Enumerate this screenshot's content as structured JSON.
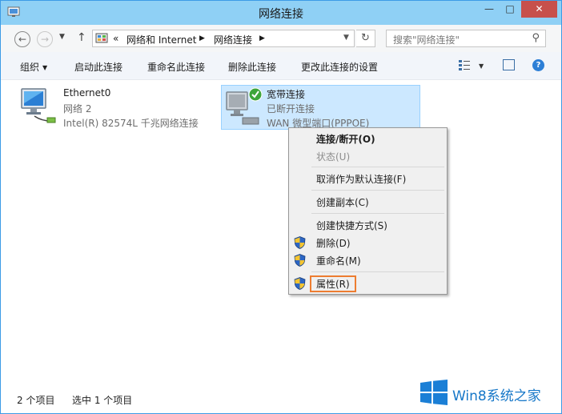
{
  "window": {
    "title": "网络连接"
  },
  "address_bar": {
    "overflow": "«",
    "segments": [
      "网络和 Internet",
      "网络连接"
    ]
  },
  "search": {
    "placeholder": "搜索\"网络连接\""
  },
  "command_bar": {
    "organize": "组织",
    "enable": "启动此连接",
    "rename": "重命名此连接",
    "delete": "删除此连接",
    "change_settings": "更改此连接的设置"
  },
  "connections": [
    {
      "name": "Ethernet0",
      "status": "网络 2",
      "device": "Intel(R) 82574L 千兆网络连接",
      "selected": false
    },
    {
      "name": "宽带连接",
      "status": "已断开连接",
      "device": "WAN 微型端口(PPPOE)",
      "selected": true
    }
  ],
  "context_menu": {
    "items": [
      {
        "label": "连接/断开(O)",
        "bold": true
      },
      {
        "label": "状态(U)",
        "disabled": true
      },
      {
        "label": "取消作为默认连接(F)"
      },
      {
        "label": "创建副本(C)"
      },
      {
        "label": "创建快捷方式(S)"
      },
      {
        "label": "删除(D)",
        "shield": true
      },
      {
        "label": "重命名(M)",
        "shield": true
      },
      {
        "label": "属性(R)",
        "shield": true,
        "highlighted": true
      }
    ]
  },
  "status_bar": {
    "item_count": "2 个项目",
    "selected_count": "选中 1 个项目"
  },
  "watermark": {
    "text": "Win8系统之家"
  },
  "colors": {
    "titlebar": "#8fd0f5",
    "selection": "#cce8ff",
    "highlight": "#ed7d31",
    "close": "#c7504b"
  }
}
